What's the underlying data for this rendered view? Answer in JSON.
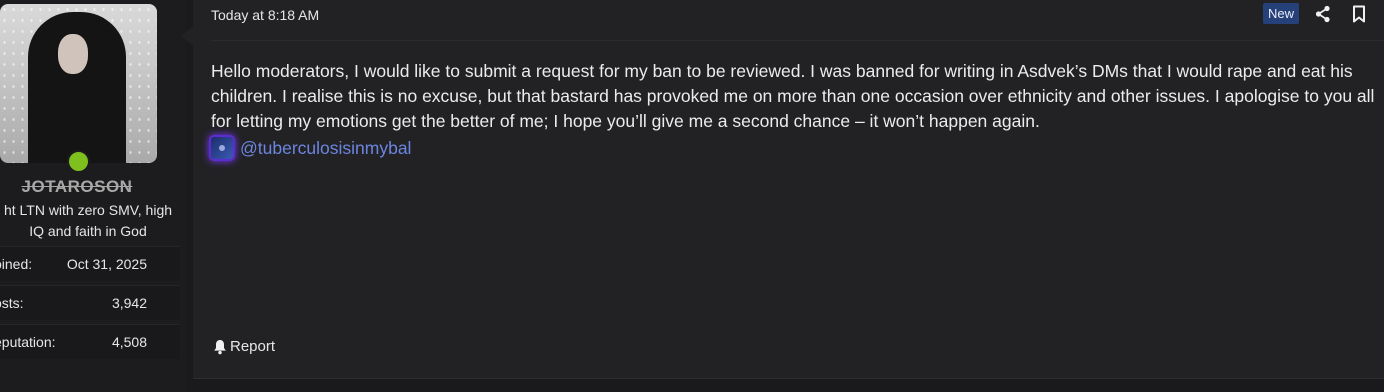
{
  "user": {
    "username": "JOTAROSON",
    "title_line1": "ht LTN with zero SMV, high",
    "title_line2": "IQ and faith in God",
    "online_color": "#7fbf1e",
    "stats": [
      {
        "label": "oined:",
        "value": "Oct 31, 2025"
      },
      {
        "label": "osts:",
        "value": "3,942"
      },
      {
        "label": "eputation:",
        "value": "4,508"
      }
    ]
  },
  "post": {
    "timestamp": "Today at 8:18 AM",
    "badge": "New",
    "icons": {
      "share": "share-icon",
      "bookmark": "bookmark-icon",
      "report": "bell-icon"
    },
    "body": "Hello moderators, I would like to submit a request for my ban to be reviewed. I was banned for writing in Asdvek’s DMs that I would rape and eat his children. I realise this is no excuse, but that bastard has provoked me on more than one occasion over ethnicity and other issues. I apologise to you all for letting my emotions get the better of me; I hope you’ll give me a second chance – it won’t happen again.",
    "mention": "@tuberculosisinmybal",
    "report_label": "Report",
    "accent_color": "#6c86e0",
    "badge_color": "#26407a"
  }
}
